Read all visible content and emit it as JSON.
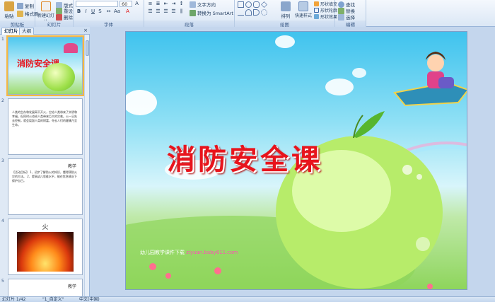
{
  "ribbon": {
    "groups": [
      {
        "label": "剪贴板"
      },
      {
        "label": "幻灯片"
      },
      {
        "label": "字体"
      },
      {
        "label": "段落"
      },
      {
        "label": "绘图"
      },
      {
        "label": "编辑"
      }
    ],
    "clipboard": {
      "paste": "粘贴",
      "copy": "复制",
      "format_painter": "格式刷"
    },
    "slides": {
      "new_slide": "新建幻灯片",
      "layout": "版式",
      "reset": "重设",
      "delete": "删除"
    },
    "font": {
      "font_name": "",
      "font_size": "60"
    },
    "paragraph": {
      "text_direction": "文字方向",
      "convert_smartart": "转换为 SmartArt"
    },
    "drawing": {
      "arrange": "排列",
      "quick_styles": "快速样式",
      "shape_fill": "形状填充",
      "shape_outline": "形状轮廓",
      "shape_effects": "形状效果"
    },
    "editing": {
      "find": "查找",
      "replace": "替换",
      "select": "选择"
    }
  },
  "left_pane": {
    "tabs": [
      {
        "label": "幻灯片"
      },
      {
        "label": "大纲"
      }
    ],
    "close": "×",
    "thumbnails": [
      {
        "num": "1",
        "title": "消防安全课"
      },
      {
        "num": "2",
        "title": "",
        "text": "人类的生存和发展离不开火，它给人类带来了文明和幸福。但同时火也给人类带来巨大的灾难。火一旦失去控制，就会烧毁人类的财富，夺去人们的健康乃至生命。"
      },
      {
        "num": "3",
        "title": "教学",
        "text": "【活动目标】 1、初步了解防火的知识，懂得预防火灾的方法。 2、提高幼儿思维水平，能在危急情况下保护自己。"
      },
      {
        "num": "4",
        "title": "火"
      },
      {
        "num": "5",
        "title": "教学"
      }
    ]
  },
  "slide": {
    "title": "消防安全课",
    "footer_text": "幼儿园教学课件下载",
    "footer_url": "ziyuan.baby611.com"
  },
  "status": {
    "slide_info": "幻灯片 1/42",
    "theme": "\"1_自定义\"",
    "language": "中文(中国)"
  },
  "colors": {
    "title_red": "#e8141c",
    "selection": "#f5b942",
    "ribbon_bg": "#dbe7f5"
  }
}
